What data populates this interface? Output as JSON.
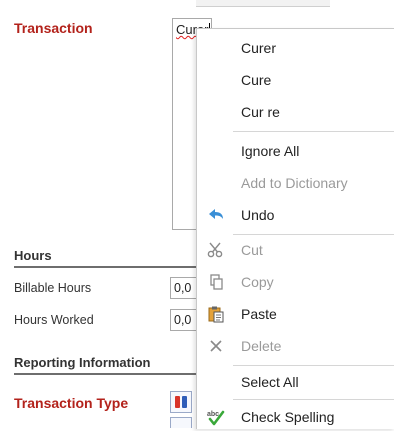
{
  "form": {
    "transaction_label": "Transaction",
    "transaction_text_misspelled": "Curer",
    "hours_section": "Hours",
    "billable_hours_label": "Billable Hours",
    "billable_hours_value": "0,0",
    "hours_worked_label": "Hours Worked",
    "hours_worked_value": "0,0",
    "reporting_section": "Reporting Information",
    "transaction_type_label": "Transaction Type"
  },
  "context_menu": {
    "suggestions": [
      "Curer",
      "Cure",
      "Cur re"
    ],
    "ignore_all": "Ignore All",
    "add_to_dictionary": "Add to Dictionary",
    "undo": "Undo",
    "cut": "Cut",
    "copy": "Copy",
    "paste": "Paste",
    "delete": "Delete",
    "select_all": "Select All",
    "check_spelling": "Check Spelling"
  },
  "colors": {
    "required_label": "#b3221b",
    "undo_icon": "#3a8fd6",
    "check_icon": "#3aa83a",
    "disabled_text": "#9a9a9a"
  },
  "icons": {
    "undo": "undo-arrow-icon",
    "cut": "scissors-icon",
    "copy": "copy-icon",
    "paste": "clipboard-icon",
    "delete": "x-icon",
    "check_spelling": "spell-check-icon"
  }
}
